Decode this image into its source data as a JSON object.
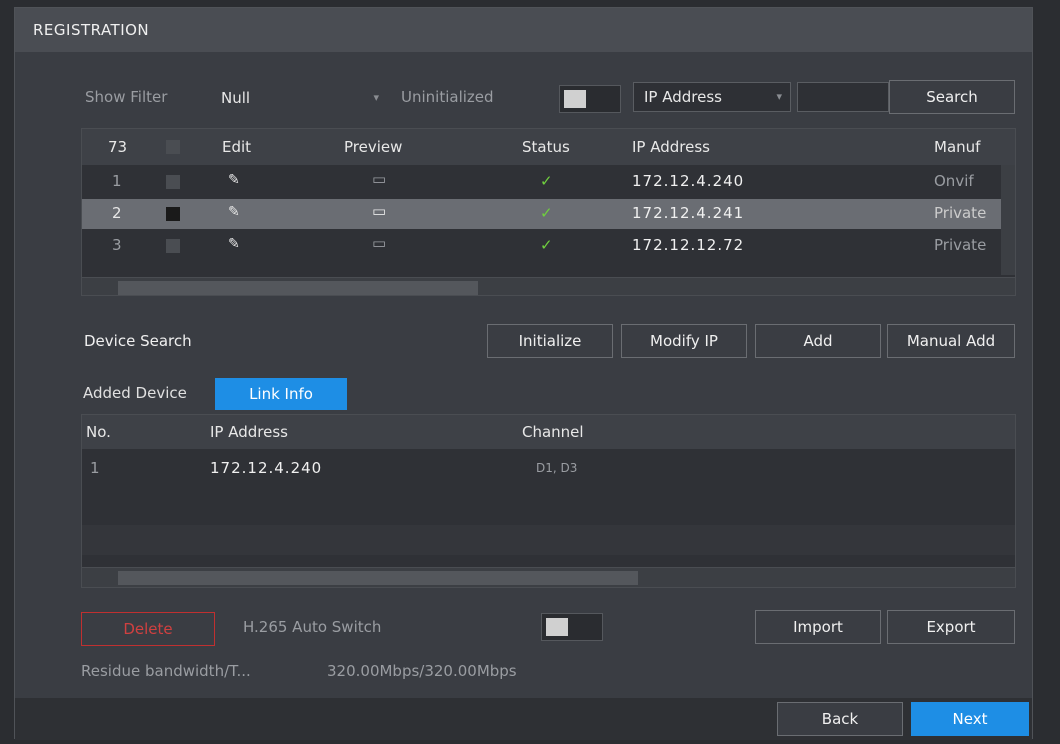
{
  "window": {
    "title": "REGISTRATION"
  },
  "filter": {
    "show_filter_label": "Show Filter",
    "null_value": "Null",
    "uninitialized_label": "Uninitialized",
    "ip_address_option": "IP Address",
    "search_label": "Search"
  },
  "device_table": {
    "count": "73",
    "headers": {
      "edit": "Edit",
      "preview": "Preview",
      "status": "Status",
      "ip": "IP Address",
      "manufacturer": "Manuf"
    },
    "rows": [
      {
        "no": "1",
        "ip": "172.12.4.240",
        "manufacturer": "Onvif",
        "selected": false,
        "status_icon": "check-icon"
      },
      {
        "no": "2",
        "ip": "172.12.4.241",
        "manufacturer": "Private",
        "selected": true,
        "status_icon": "check-icon"
      },
      {
        "no": "3",
        "ip": "172.12.12.72",
        "manufacturer": "Private",
        "selected": false,
        "status_icon": "check-icon"
      }
    ]
  },
  "actions": {
    "device_search": "Device Search",
    "initialize": "Initialize",
    "modify_ip": "Modify IP",
    "add": "Add",
    "manual_add": "Manual Add"
  },
  "tabs": {
    "added_device": "Added Device",
    "link_info": "Link Info"
  },
  "added_table": {
    "headers": {
      "no": "No.",
      "ip": "IP Address",
      "channel": "Channel"
    },
    "rows": [
      {
        "no": "1",
        "ip": "172.12.4.240",
        "channel": "D1, D3"
      }
    ]
  },
  "footer": {
    "delete": "Delete",
    "h265_label": "H.265 Auto Switch",
    "import": "Import",
    "export": "Export",
    "bandwidth_label": "Residue bandwidth/T...",
    "bandwidth_value": "320.00Mbps/320.00Mbps"
  },
  "nav": {
    "back": "Back",
    "next": "Next"
  }
}
